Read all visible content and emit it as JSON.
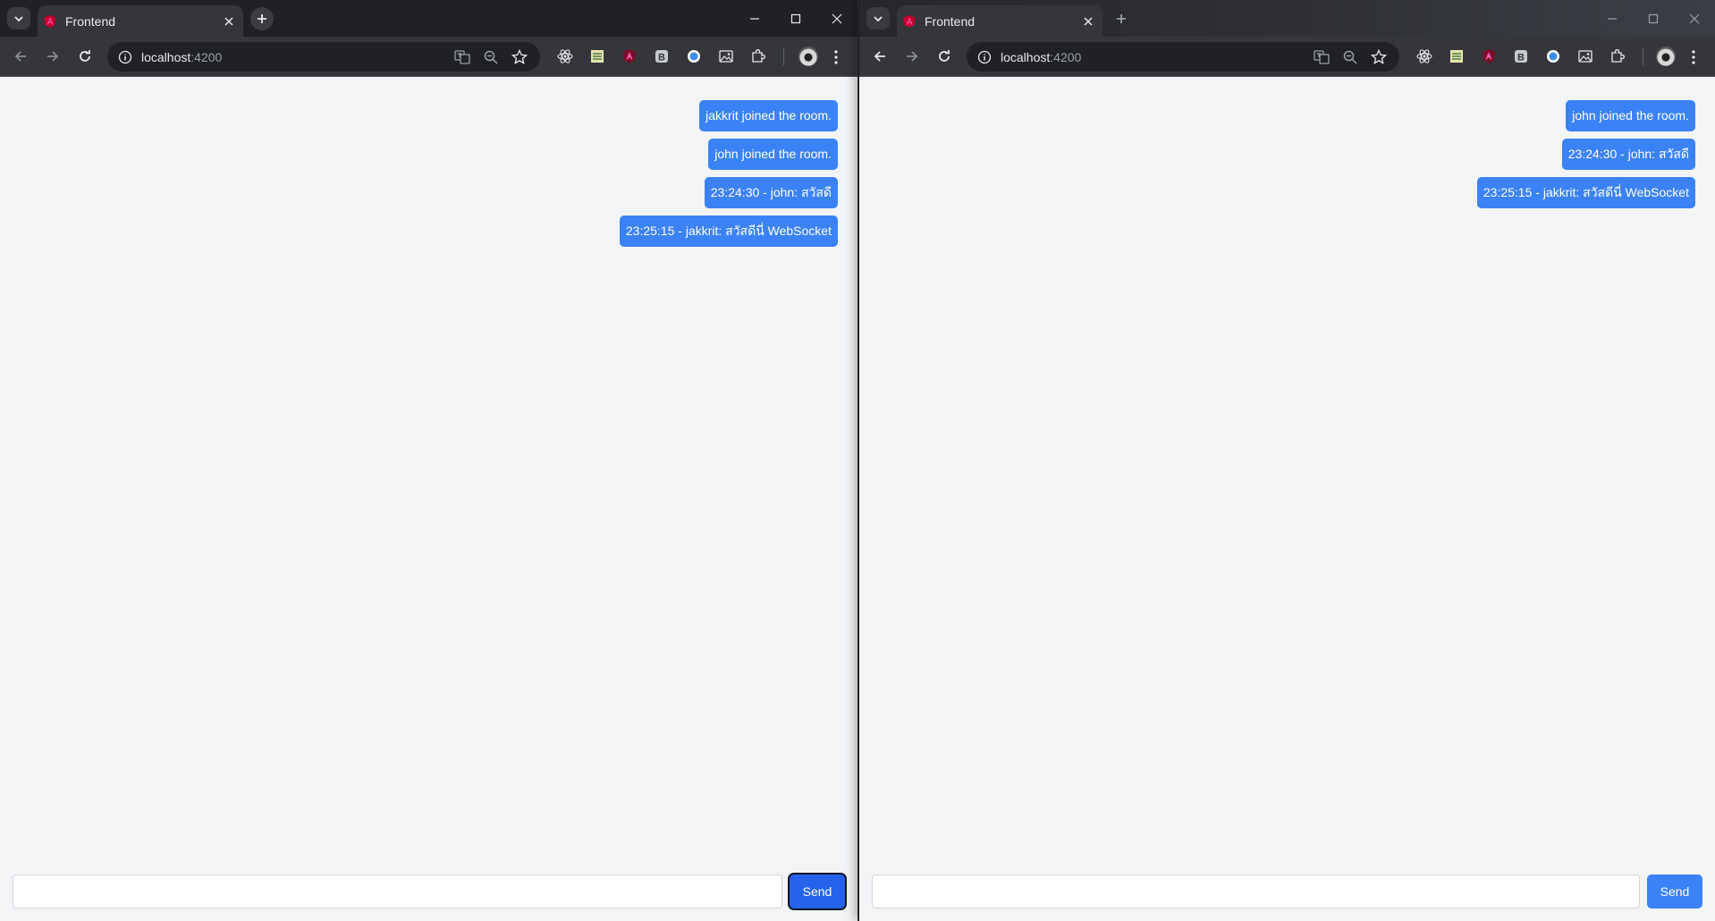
{
  "windows": [
    {
      "tab_title": "Frontend",
      "url_host": "localhost",
      "url_port": ":4200",
      "messages": [
        "jakkrit joined the room.",
        "john joined the room.",
        "23:24:30 - john: สวัสดี",
        "23:25:15 - jakkrit: สวัสดีนี่ WebSocket"
      ],
      "input_value": "",
      "send_label": "Send"
    },
    {
      "tab_title": "Frontend",
      "url_host": "localhost",
      "url_port": ":4200",
      "messages": [
        "john joined the room.",
        "23:24:30 - john: สวัสดี",
        "23:25:15 - jakkrit: สวัสดีนี่ WebSocket"
      ],
      "input_value": "",
      "send_label": "Send"
    }
  ],
  "colors": {
    "bubble": "#3b82f6",
    "send_focused": "#2563eb",
    "page_bg": "#f3f4f6",
    "chrome_dark": "#202124"
  },
  "icons": [
    "tab-search-icon",
    "angular-icon",
    "close-icon",
    "plus-icon",
    "minimize-icon",
    "maximize-icon",
    "back-icon",
    "forward-icon",
    "reload-icon",
    "info-icon",
    "translate-icon",
    "zoom-icon",
    "star-icon",
    "react-devtools-icon",
    "sheet-extension-icon",
    "angular-devtools-icon",
    "b-extension-icon",
    "circle-extension-icon",
    "image-extension-icon",
    "puzzle-icon",
    "avatar",
    "kebab-menu-icon"
  ]
}
